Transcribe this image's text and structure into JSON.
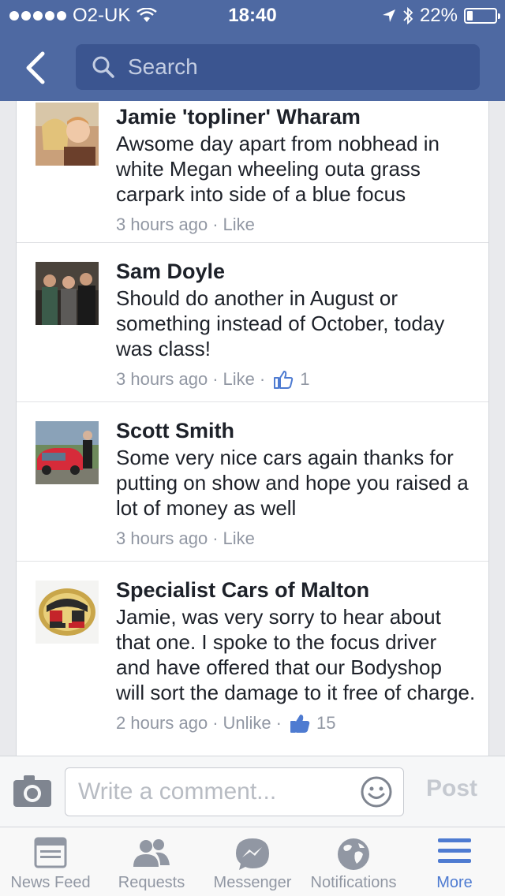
{
  "status_bar": {
    "carrier": "O2-UK",
    "time": "18:40",
    "battery": "22%",
    "battery_fraction": 0.22
  },
  "nav": {
    "search_placeholder": "Search"
  },
  "comments": [
    {
      "name": "Jamie 'topliner' Wharam",
      "text": "Awsome day apart from nobhead in white Megan wheeling outa grass carpark into side of a blue focus",
      "time": "3 hours ago",
      "action": "Like",
      "likes": ""
    },
    {
      "name": "Sam Doyle",
      "text": "Should do another in August or something instead of October, today was class!",
      "time": "3 hours ago",
      "action": "Like",
      "likes": "1"
    },
    {
      "name": "Scott Smith",
      "text": "Some very nice cars again thanks for putting on show and hope you raised a lot of money as well",
      "time": "3 hours ago",
      "action": "Like",
      "likes": ""
    },
    {
      "name": "Specialist Cars of Malton",
      "text": "Jamie, was very sorry to hear about that one. I spoke to the focus driver and have offered that our Bodyshop will sort the damage to it free of charge.",
      "time": "2 hours ago",
      "action": "Unlike",
      "likes": "15"
    }
  ],
  "composer": {
    "placeholder": "Write a comment...",
    "post_label": "Post"
  },
  "tabs": [
    {
      "label": "News Feed",
      "icon": "news-feed-icon"
    },
    {
      "label": "Requests",
      "icon": "friends-icon"
    },
    {
      "label": "Messenger",
      "icon": "messenger-icon"
    },
    {
      "label": "Notifications",
      "icon": "globe-icon"
    },
    {
      "label": "More",
      "icon": "menu-icon"
    }
  ],
  "colors": {
    "brand": "#4e69a2",
    "active_tab": "#4e7bd1",
    "like_blue": "#4e7bd1"
  }
}
